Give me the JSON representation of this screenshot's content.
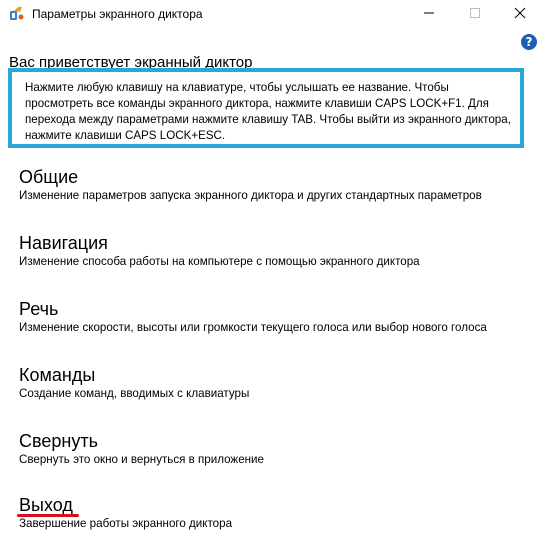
{
  "window": {
    "title": "Параметры экранного диктора",
    "app_icon": "narrator-icon",
    "controls": [
      "minimize-icon",
      "maximize-icon",
      "close-icon"
    ],
    "help_icon": "help-icon",
    "help_symbol": "?"
  },
  "welcome": "Вас приветствует экранный диктор",
  "info": {
    "lines": [
      "Нажмите любую клавишу на клавиатуре, чтобы услышать ее название. Чтобы",
      "просмотреть все команды экранного диктора, нажмите клавиши CAPS LOCK+F1. Для",
      "перехода между параметрами нажмите клавишу TAB. Чтобы выйти из экранного диктора,",
      "нажмите клавиши CAPS LOCK+ESC."
    ],
    "border_color": "#2aa6d9"
  },
  "menu": {
    "items": [
      {
        "title": "Общие",
        "description": "Изменение параметров запуска экранного диктора и других стандартных параметров"
      },
      {
        "title": "Навигация",
        "description": "Изменение способа работы на компьютере с помощью экранного диктора"
      },
      {
        "title": "Речь",
        "description": "Изменение скорости, высоты или громкости текущего голоса или выбор нового голоса"
      },
      {
        "title": "Команды",
        "description": "Создание команд, вводимых с клавиатуры"
      },
      {
        "title": "Свернуть",
        "description": "Свернуть это окно и вернуться в приложение"
      },
      {
        "title": "Выход",
        "description": "Завершение работы экранного диктора"
      }
    ]
  },
  "colors": {
    "accent": "#2aa6d9",
    "help": "#1a5fb4",
    "highlight_underline": "#d1121d"
  }
}
